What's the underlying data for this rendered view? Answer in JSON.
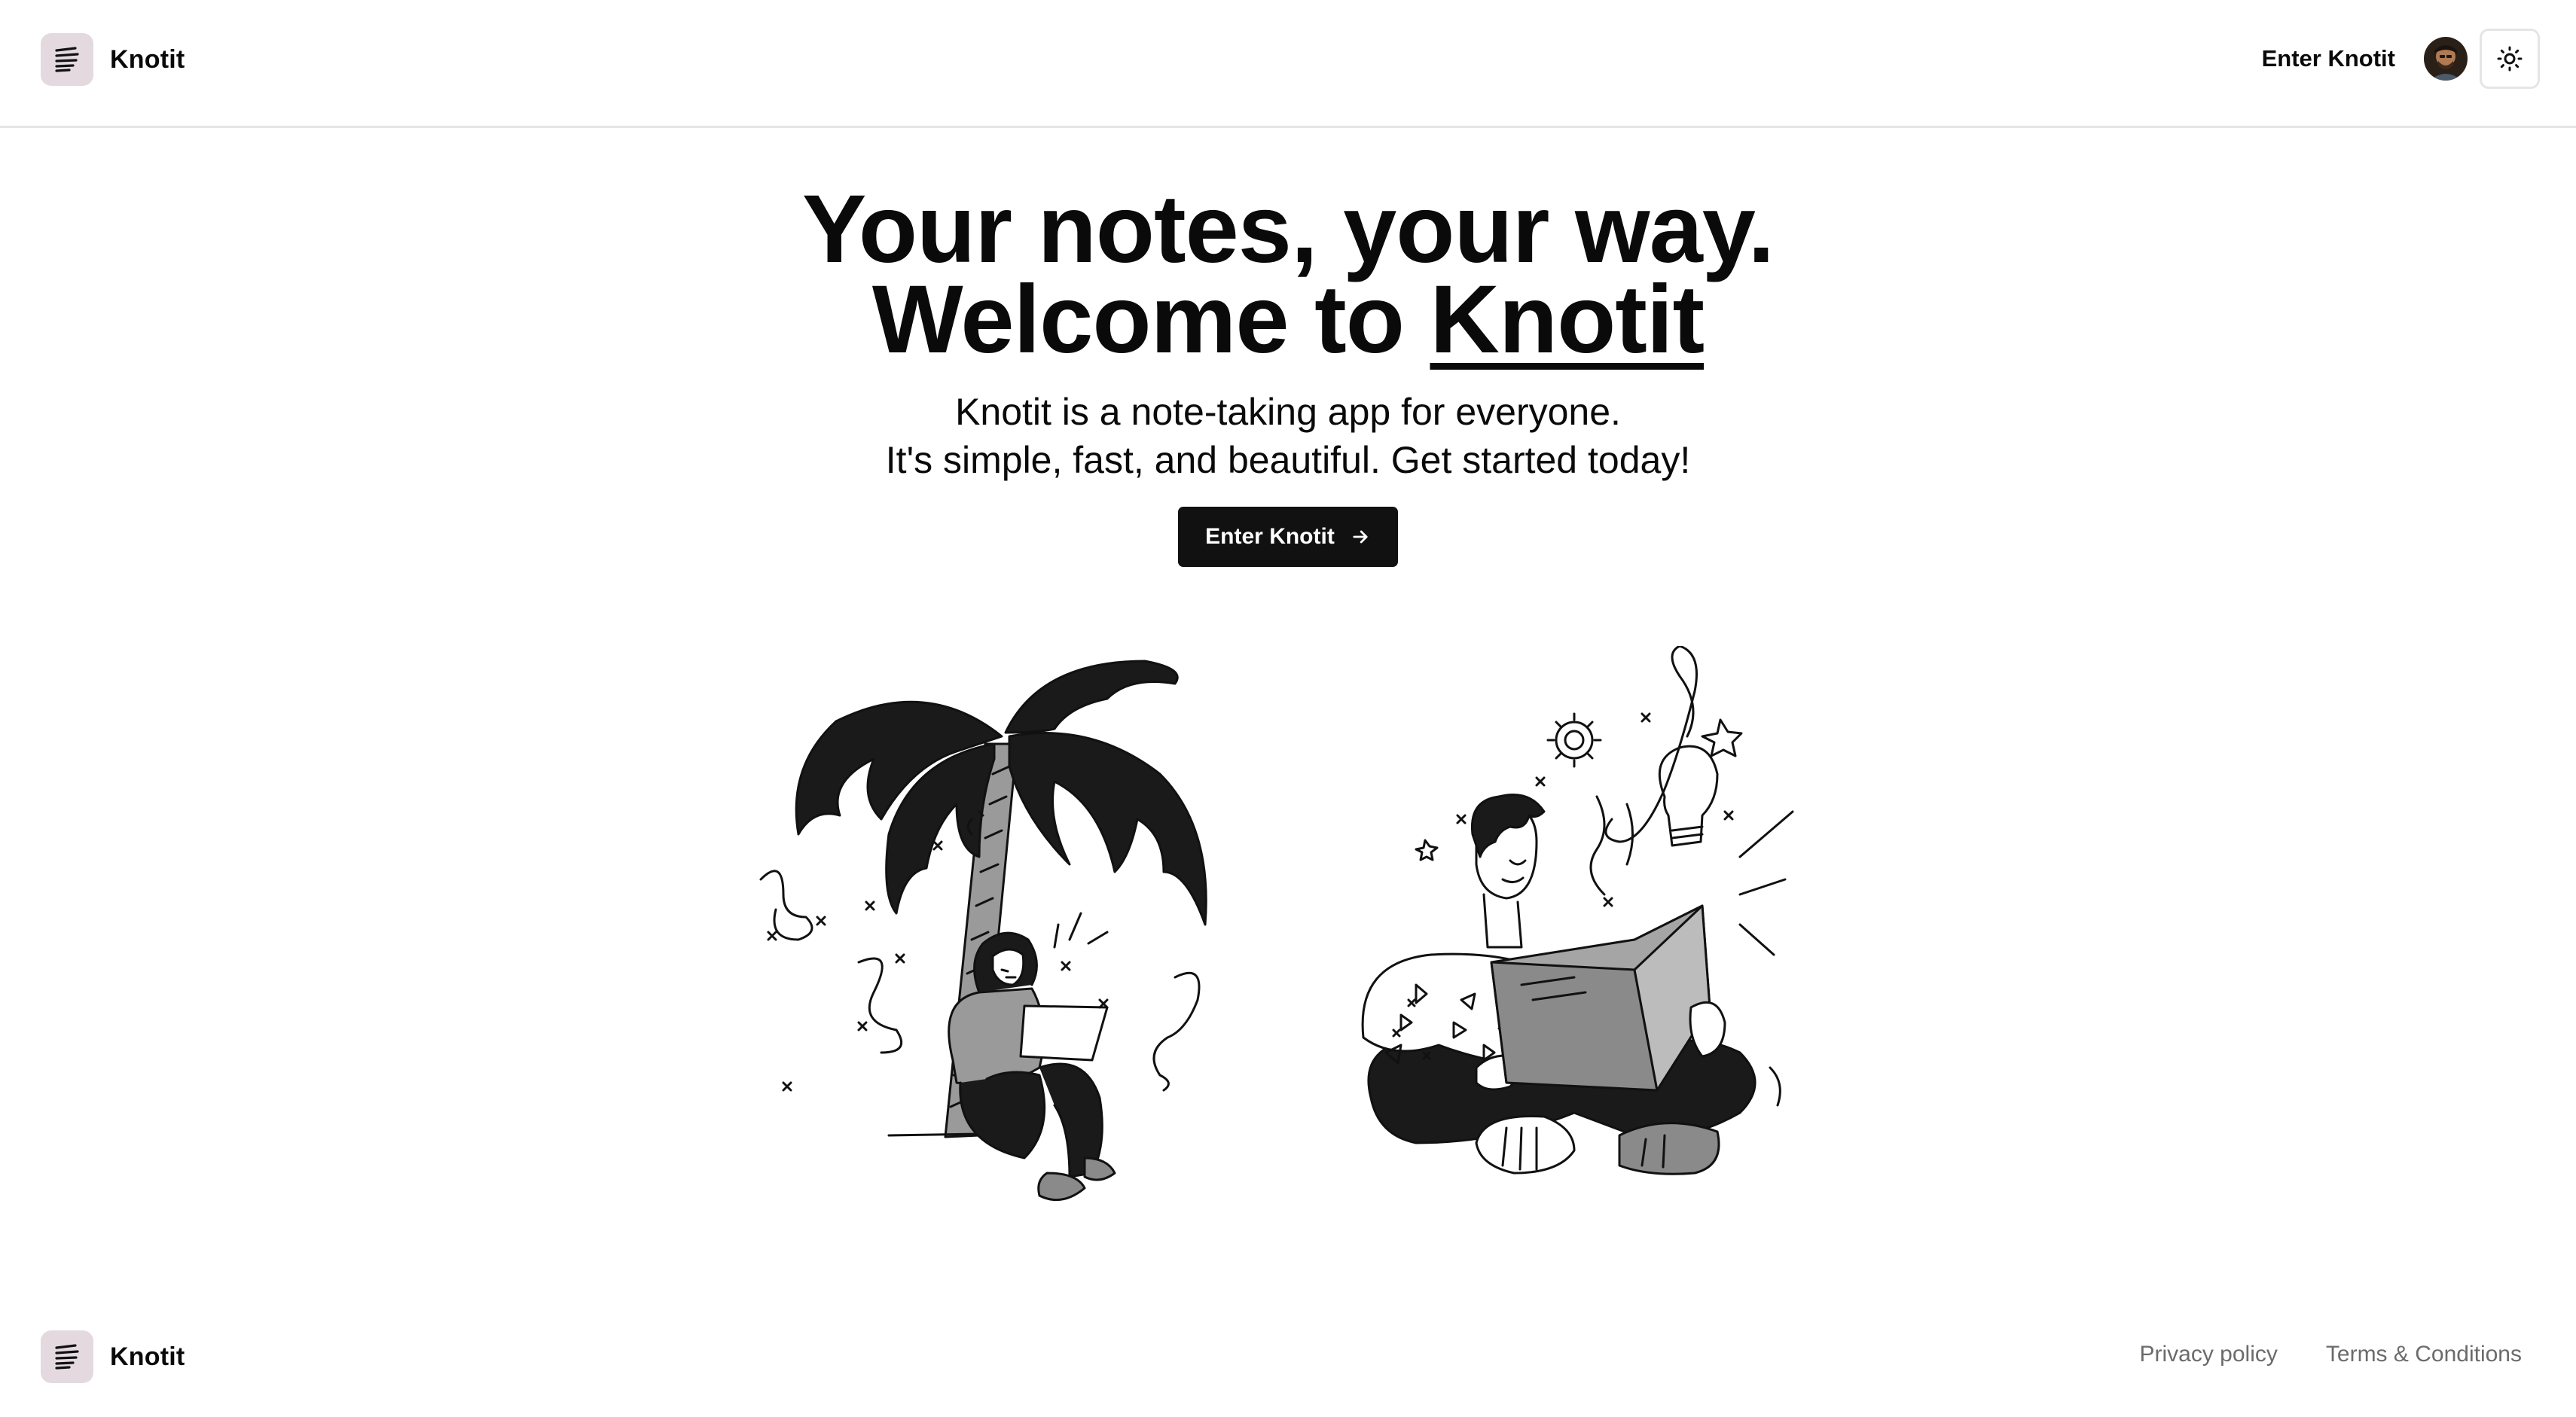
{
  "header": {
    "brand_name": "Knotit",
    "nav_enter": "Enter Knotit",
    "icons": {
      "logo": "lines-logo-icon",
      "avatar": "user-avatar",
      "theme": "sun-icon"
    }
  },
  "hero": {
    "title_line1": "Your notes, your way.",
    "title_line2_prefix": "Welcome to ",
    "title_line2_brand": "Knotit",
    "subtitle_line1": "Knotit is a note-taking app for everyone.",
    "subtitle_line2": "It's simple, fast, and beautiful. Get started today!",
    "cta_label": "Enter Knotit",
    "cta_icon": "arrow-right-icon"
  },
  "illustrations": {
    "left": "person-reading-under-palm-tree",
    "right": "person-reading-book-with-ideas"
  },
  "footer": {
    "brand_name": "Knotit",
    "links": [
      "Privacy policy",
      "Terms & Conditions"
    ]
  },
  "colors": {
    "logo_bg": "#e4d9df",
    "cta_bg": "#111111",
    "border": "#e5e5e5",
    "footer_link": "#6b6b6b"
  }
}
